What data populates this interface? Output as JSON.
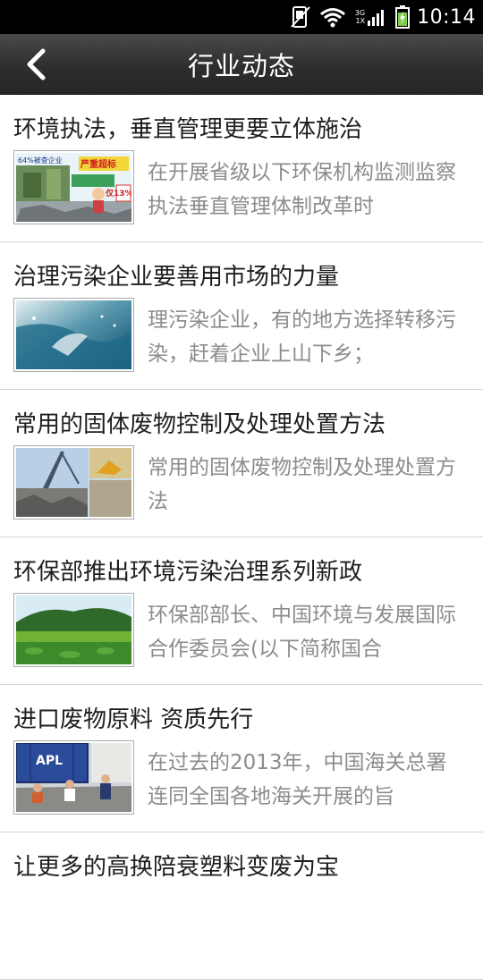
{
  "status_bar": {
    "network_top": "3G",
    "network_bottom": "1X",
    "time": "10:14",
    "icons": [
      "mute-icon",
      "wifi-icon",
      "signal-icon",
      "battery-charging-icon"
    ]
  },
  "nav": {
    "back_icon": "chevron-left-icon",
    "title": "行业动态"
  },
  "news": [
    {
      "title": "环境执法，垂直管理更要立体施治",
      "summary": "在开展省级以下环保机构监测监察执法垂直管理体制改革时",
      "thumb_text_1": "64%被查企业",
      "thumb_text_2": "严重超标",
      "thumb_text_3": "仅13%"
    },
    {
      "title": "治理污染企业要善用市场的力量",
      "summary": "理污染企业，有的地方选择转移污染，赶着企业上山下乡；"
    },
    {
      "title": "常用的固体废物控制及处理处置方法",
      "summary": "常用的固体废物控制及处理处置方法"
    },
    {
      "title": "环保部推出环境污染治理系列新政",
      "summary": "环保部部长、中国环境与发展国际合作委员会(以下简称国合"
    },
    {
      "title": "进口废物原料 资质先行",
      "summary": "在过去的2013年，中国海关总署连同全国各地海关开展的旨",
      "thumb_text_1": "APL"
    },
    {
      "title": "让更多的高换陪衰塑料变废为宝",
      "summary": ""
    }
  ]
}
